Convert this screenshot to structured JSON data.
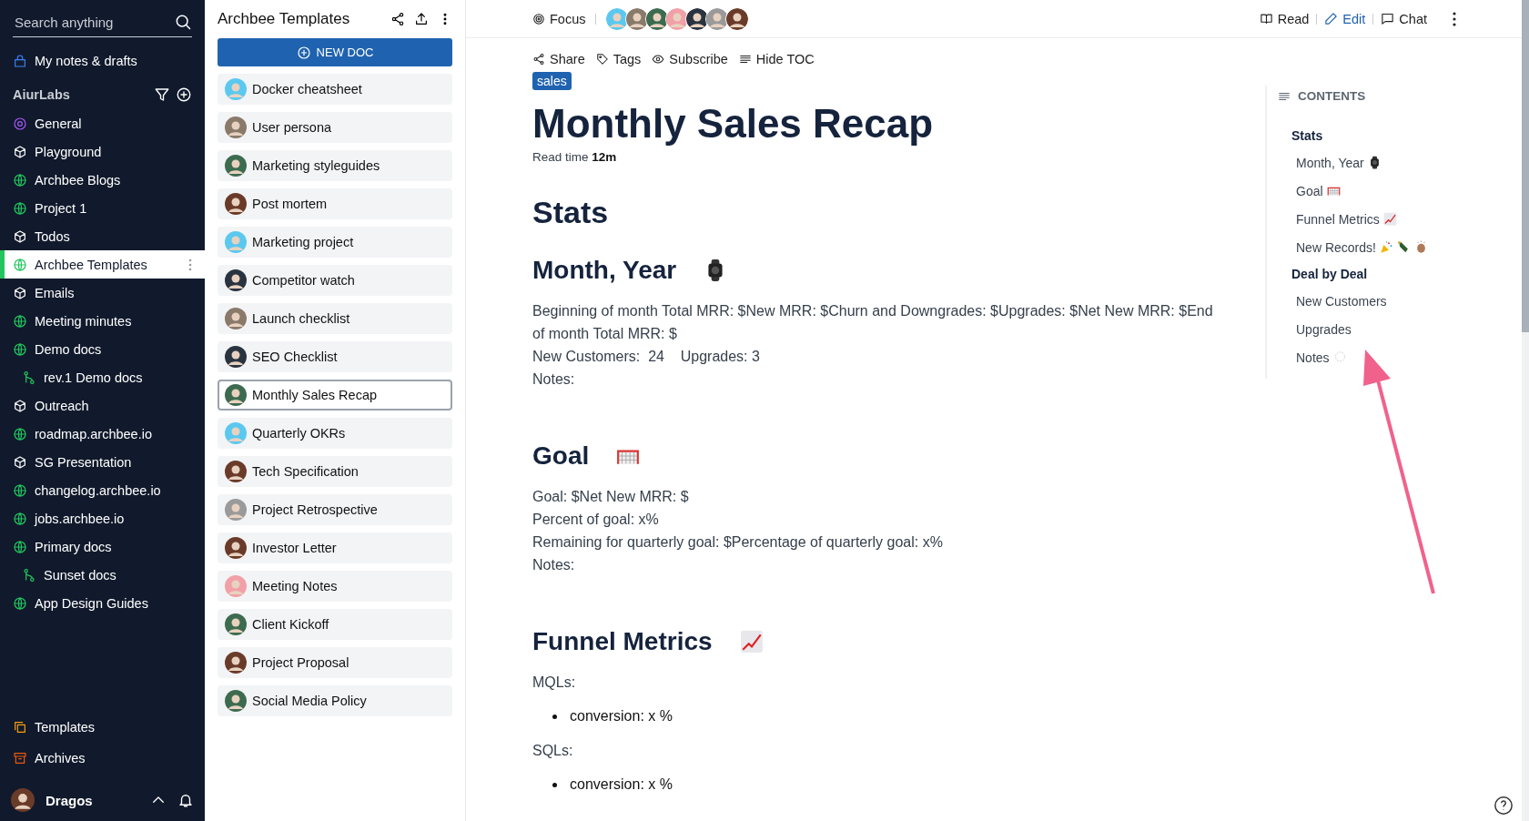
{
  "sidebar": {
    "search": {
      "placeholder": "Search anything"
    },
    "personal": {
      "label": "My notes & drafts"
    },
    "workspace": {
      "title": "AiurLabs"
    },
    "items": [
      {
        "label": "General",
        "kind": "target",
        "selected": false
      },
      {
        "label": "Playground",
        "kind": "cube",
        "selected": false
      },
      {
        "label": "Archbee Blogs",
        "kind": "globe",
        "selected": false
      },
      {
        "label": "Project 1",
        "kind": "globe",
        "selected": false
      },
      {
        "label": "Todos",
        "kind": "cube",
        "selected": false
      },
      {
        "label": "Archbee Templates",
        "kind": "globe",
        "selected": true
      },
      {
        "label": "Emails",
        "kind": "cube",
        "selected": false
      },
      {
        "label": "Meeting minutes",
        "kind": "globe",
        "selected": false
      },
      {
        "label": "Demo docs",
        "kind": "globe",
        "selected": false,
        "children": [
          {
            "label": "rev.1 Demo docs",
            "kind": "branch",
            "selected": false
          }
        ]
      },
      {
        "label": "Outreach",
        "kind": "cube",
        "selected": false
      },
      {
        "label": "roadmap.archbee.io",
        "kind": "globe",
        "selected": false
      },
      {
        "label": "SG Presentation",
        "kind": "cube",
        "selected": false
      },
      {
        "label": "changelog.archbee.io",
        "kind": "globe",
        "selected": false
      },
      {
        "label": "jobs.archbee.io",
        "kind": "globe",
        "selected": false
      },
      {
        "label": "Primary docs",
        "kind": "globe",
        "selected": false,
        "children": [
          {
            "label": "Sunset docs",
            "kind": "branch",
            "selected": false
          }
        ]
      },
      {
        "label": "App Design Guides",
        "kind": "globe",
        "selected": false
      }
    ],
    "bottom": [
      {
        "label": "Templates",
        "kind": "templates"
      },
      {
        "label": "Archives",
        "kind": "archive"
      }
    ],
    "user": {
      "name": "Dragos"
    }
  },
  "doclist": {
    "title": "Archbee Templates",
    "new_button": "NEW DOC",
    "docs": [
      {
        "title": "Docker cheatsheet",
        "color": "#5bc8f0",
        "selected": false
      },
      {
        "title": "User persona",
        "color": "#8a7a6a",
        "selected": false
      },
      {
        "title": "Marketing styleguides",
        "color": "#3d6b4f",
        "selected": false
      },
      {
        "title": "Post mortem",
        "color": "#6b3b2a",
        "selected": false
      },
      {
        "title": "Marketing project",
        "color": "#5bc8f0",
        "selected": false
      },
      {
        "title": "Competitor watch",
        "color": "#2a3440",
        "selected": false
      },
      {
        "title": "Launch checklist",
        "color": "#8a7a6a",
        "selected": false
      },
      {
        "title": "SEO Checklist",
        "color": "#2a3440",
        "selected": false
      },
      {
        "title": "Monthly Sales Recap",
        "color": "#3d6b4f",
        "selected": true
      },
      {
        "title": "Quarterly OKRs",
        "color": "#5bc8f0",
        "selected": false
      },
      {
        "title": "Tech Specification",
        "color": "#6b3b2a",
        "selected": false
      },
      {
        "title": "Project Retrospective",
        "color": "#9a9a9a",
        "selected": false
      },
      {
        "title": "Investor Letter",
        "color": "#6b3b2a",
        "selected": false
      },
      {
        "title": "Meeting Notes",
        "color": "#f2a0a8",
        "selected": false
      },
      {
        "title": "Client Kickoff",
        "color": "#3d6b4f",
        "selected": false
      },
      {
        "title": "Project Proposal",
        "color": "#6b3b2a",
        "selected": false
      },
      {
        "title": "Social Media Policy",
        "color": "#3d6b4f",
        "selected": false
      }
    ]
  },
  "header": {
    "focus": "Focus",
    "collaborators": [
      {
        "color": "#5bc8f0"
      },
      {
        "color": "#8a7a6a"
      },
      {
        "color": "#3d6b4f"
      },
      {
        "color": "#f2a0a8"
      },
      {
        "color": "#2a3440"
      },
      {
        "color": "#9a9a9a"
      },
      {
        "color": "#6b3b2a"
      }
    ],
    "modes": [
      {
        "label": "Read",
        "kind": "book",
        "selected": false
      },
      {
        "label": "Edit",
        "kind": "pencil",
        "selected": true
      },
      {
        "label": "Chat",
        "kind": "chat",
        "selected": false
      }
    ]
  },
  "toolbar": [
    {
      "label": "Share",
      "kind": "share"
    },
    {
      "label": "Tags",
      "kind": "tag"
    },
    {
      "label": "Subscribe",
      "kind": "eye"
    },
    {
      "label": "Hide TOC",
      "kind": "lines"
    }
  ],
  "document": {
    "tag": "sales",
    "title": "Monthly Sales Recap",
    "read_time": "Read time **12m**",
    "blocks": [
      {
        "kind": "h1",
        "text": "Stats"
      },
      {
        "kind": "h2",
        "text": "Month, Year",
        "emoji": {
          "kind": "watch"
        }
      },
      {
        "kind": "p",
        "text": "Beginning of month Total MRR: $New MRR: $Churn and Downgrades: $Upgrades: $Net New MRR: $End of month Total MRR: $"
      },
      {
        "kind": "p",
        "text": "New Customers:  24    Upgrades: 3"
      },
      {
        "kind": "p",
        "text": "Notes:"
      },
      {
        "kind": "h2",
        "text": "Goal",
        "emoji": {
          "kind": "goal"
        }
      },
      {
        "kind": "p",
        "text": "Goal: $Net New MRR: $"
      },
      {
        "kind": "p",
        "text": "Percent of goal: x%"
      },
      {
        "kind": "p",
        "text": "Remaining for quarterly goal: $Percentage of quarterly goal: x%"
      },
      {
        "kind": "p",
        "text": "Notes:"
      },
      {
        "kind": "h2",
        "text": "Funnel Metrics",
        "emoji": {
          "kind": "chart"
        }
      },
      {
        "kind": "p",
        "text": "MQLs:"
      },
      {
        "kind": "li",
        "text": "conversion: x %"
      },
      {
        "kind": "p",
        "text": "SQLs:"
      },
      {
        "kind": "li",
        "text": "conversion: x %"
      }
    ]
  },
  "toc": {
    "title": "CONTENTS",
    "entries": [
      {
        "label": "Stats",
        "kind": "section"
      },
      {
        "label": "Month, Year",
        "kind": "entry",
        "emojis": [
          {
            "kind": "watch"
          }
        ]
      },
      {
        "label": "Goal",
        "kind": "entry",
        "emojis": [
          {
            "kind": "goal"
          }
        ]
      },
      {
        "label": "Funnel Metrics",
        "kind": "entry",
        "emojis": [
          {
            "kind": "chart"
          }
        ]
      },
      {
        "label": "New Records!",
        "kind": "entry",
        "emojis": [
          {
            "kind": "party"
          },
          {
            "kind": "bottle"
          },
          {
            "kind": "clap"
          }
        ]
      },
      {
        "label": "Deal by Deal",
        "kind": "section"
      },
      {
        "label": "New Customers",
        "kind": "entry"
      },
      {
        "label": "Upgrades",
        "kind": "entry"
      },
      {
        "label": "Notes",
        "kind": "entry",
        "emojis": [
          {
            "kind": "bubble"
          }
        ]
      }
    ]
  }
}
